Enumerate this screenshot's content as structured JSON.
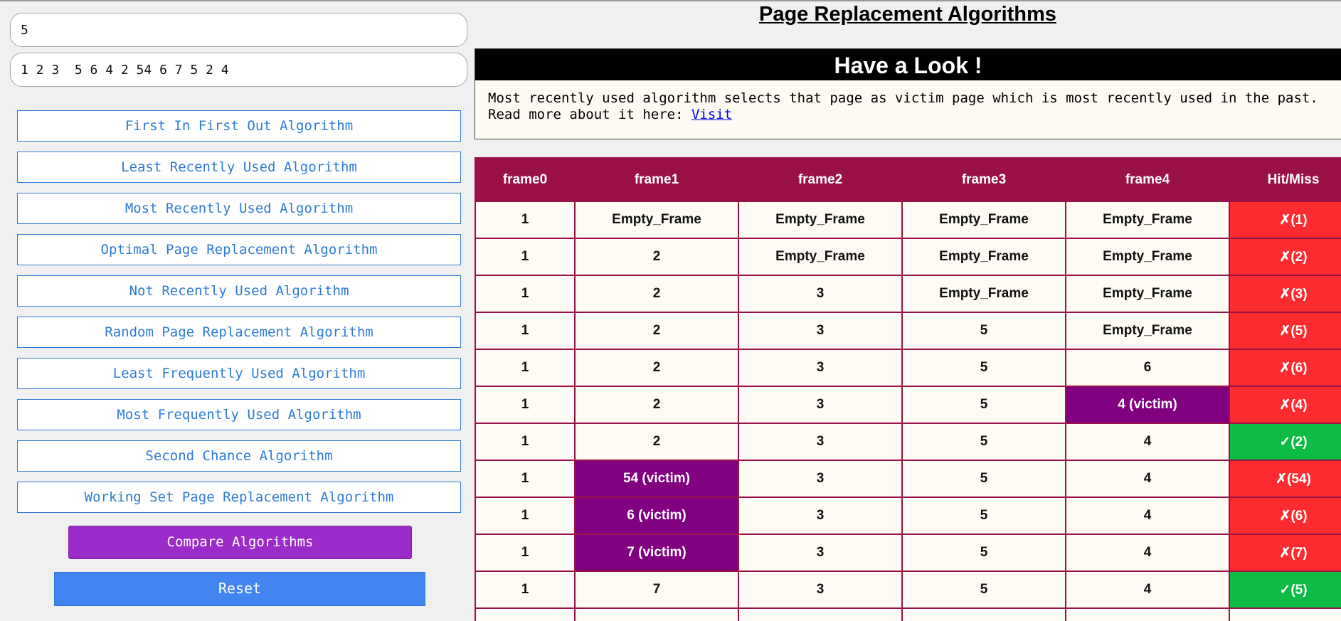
{
  "inputs": {
    "frames_value": "5",
    "reference_value": "1 2 3  5 6 4 2 54 6 7 5 2 4"
  },
  "algorithms": [
    "First In First Out Algorithm",
    "Least Recently Used Algorithm",
    "Most Recently Used Algorithm",
    "Optimal Page Replacement Algorithm",
    "Not Recently Used Algorithm",
    "Random Page Replacement Algorithm",
    "Least Frequently Used Algorithm",
    "Most Frequently Used Algorithm",
    "Second Chance Algorithm",
    "Working Set Page Replacement Algorithm"
  ],
  "compare_label": "Compare Algorithms",
  "reset_label": "Reset",
  "title": "Page Replacement Algorithms",
  "look": {
    "header": "Have a Look !",
    "line1": "Most recently used algorithm selects that page as victim page which is most recently used in the past.",
    "line2_prefix": "Read more about it here: ",
    "link_label": "Visit"
  },
  "table": {
    "headers": [
      "frame0",
      "frame1",
      "frame2",
      "frame3",
      "frame4",
      "Hit/Miss"
    ],
    "rows": [
      {
        "cells": [
          "1",
          "Empty_Frame",
          "Empty_Frame",
          "Empty_Frame",
          "Empty_Frame"
        ],
        "victim": -1,
        "result": "✗(1)",
        "status": "miss"
      },
      {
        "cells": [
          "1",
          "2",
          "Empty_Frame",
          "Empty_Frame",
          "Empty_Frame"
        ],
        "victim": -1,
        "result": "✗(2)",
        "status": "miss"
      },
      {
        "cells": [
          "1",
          "2",
          "3",
          "Empty_Frame",
          "Empty_Frame"
        ],
        "victim": -1,
        "result": "✗(3)",
        "status": "miss"
      },
      {
        "cells": [
          "1",
          "2",
          "3",
          "5",
          "Empty_Frame"
        ],
        "victim": -1,
        "result": "✗(5)",
        "status": "miss"
      },
      {
        "cells": [
          "1",
          "2",
          "3",
          "5",
          "6"
        ],
        "victim": -1,
        "result": "✗(6)",
        "status": "miss"
      },
      {
        "cells": [
          "1",
          "2",
          "3",
          "5",
          "4 (victim)"
        ],
        "victim": 4,
        "result": "✗(4)",
        "status": "miss"
      },
      {
        "cells": [
          "1",
          "2",
          "3",
          "5",
          "4"
        ],
        "victim": -1,
        "result": "✓(2)",
        "status": "hit"
      },
      {
        "cells": [
          "1",
          "54 (victim)",
          "3",
          "5",
          "4"
        ],
        "victim": 1,
        "result": "✗(54)",
        "status": "miss"
      },
      {
        "cells": [
          "1",
          "6 (victim)",
          "3",
          "5",
          "4"
        ],
        "victim": 1,
        "result": "✗(6)",
        "status": "miss"
      },
      {
        "cells": [
          "1",
          "7 (victim)",
          "3",
          "5",
          "4"
        ],
        "victim": 1,
        "result": "✗(7)",
        "status": "miss"
      },
      {
        "cells": [
          "1",
          "7",
          "3",
          "5",
          "4"
        ],
        "victim": -1,
        "result": "✓(5)",
        "status": "hit"
      },
      {
        "cells": [
          "",
          "",
          "",
          "",
          ""
        ],
        "victim": -1,
        "result": "",
        "status": "none"
      }
    ]
  },
  "colors": {
    "table_border": "#991147",
    "victim": "#800080",
    "miss": "#fb2b30",
    "hit": "#0ebb46",
    "compare_button": "#9b2cc9",
    "reset_button": "#4285f0",
    "algo_button_text": "#2f7ad6"
  }
}
